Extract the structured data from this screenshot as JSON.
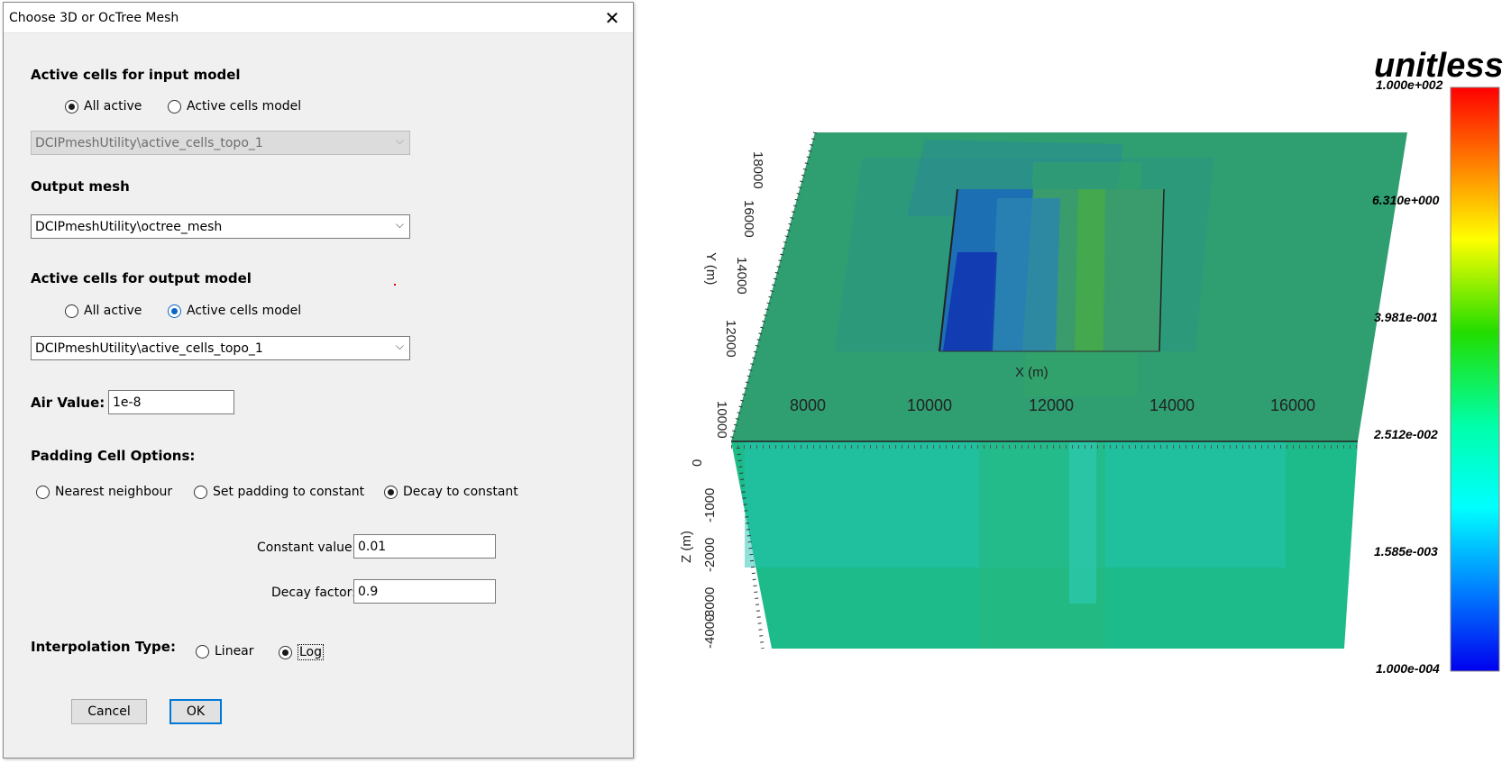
{
  "dialog": {
    "title": "Choose 3D or OcTree Mesh",
    "input_section": {
      "title": "Active cells for input model",
      "options": [
        "All active",
        "Active cells model"
      ],
      "selected": "All active",
      "combo_value": "DCIPmeshUtility\\active_cells_topo_1"
    },
    "output_mesh": {
      "title": "Output mesh",
      "combo_value": "DCIPmeshUtility\\octree_mesh"
    },
    "output_section": {
      "title": "Active cells for output model",
      "options": [
        "All active",
        "Active cells model"
      ],
      "selected": "Active cells model",
      "combo_value": "DCIPmeshUtility\\active_cells_topo_1"
    },
    "air_value": {
      "label": "Air Value:",
      "value": "1e-8"
    },
    "padding": {
      "title": "Padding Cell Options:",
      "options": [
        "Nearest neighbour",
        "Set padding to constant",
        "Decay to constant"
      ],
      "selected": "Decay to constant",
      "constant_label": "Constant value:",
      "constant_value": "0.01",
      "decay_label": "Decay factor:",
      "decay_value": "0.9"
    },
    "interpolation": {
      "title": "Interpolation Type:",
      "options": [
        "Linear",
        "Log"
      ],
      "selected": "Log"
    },
    "buttons": {
      "cancel": "Cancel",
      "ok": "OK"
    }
  },
  "viewer": {
    "x_ticks": [
      "8000",
      "10000",
      "12000",
      "14000",
      "16000"
    ],
    "x_label": "X (m)",
    "y_ticks": [
      "10000",
      "12000",
      "14000",
      "16000",
      "18000"
    ],
    "y_label": "Y (m)",
    "z_ticks": [
      "0",
      "-1000",
      "-2000",
      "-3000",
      "-4000"
    ],
    "z_label": "Z (m)",
    "colorbar": {
      "title": "unitless",
      "ticks": [
        "1.000e+002",
        "6.310e+000",
        "3.981e-001",
        "2.512e-002",
        "1.585e-003",
        "1.000e-004"
      ],
      "colors": [
        "#ff0000",
        "#ff8c00",
        "#ffff00",
        "#00dd00",
        "#00ffb0",
        "#00ffff",
        "#0080ff",
        "#0000ff"
      ]
    }
  }
}
